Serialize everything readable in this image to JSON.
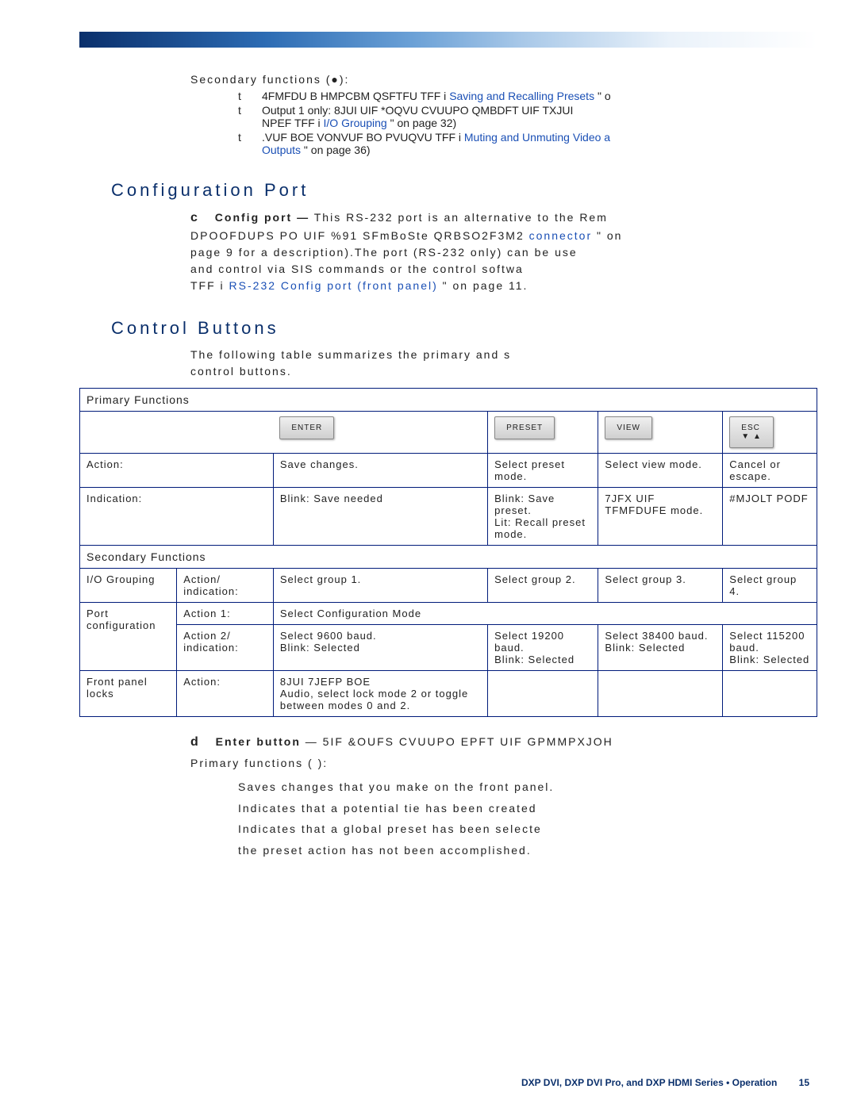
{
  "secondary_label": "Secondary functions (●):",
  "bullets": [
    {
      "pre": "t",
      "garble": "4FMFDU B HMPCBM QSFTFU TFF i",
      "link": "Saving and Recalling Presets",
      "post": "\"  o"
    },
    {
      "pre": "t",
      "garble": "Output 1 only:  8JUI UIF *OQVU  CVUUPO QMBDFT UIF TXJUI",
      "line2": "NPEF TFF i",
      "link": "I/O Grouping",
      "post": "\"  on page 32)"
    },
    {
      "pre": "t",
      "garble": ".VUF BOE VONVUF BO PVUQVU TFF i",
      "link": "Muting and Unmuting Video a",
      "line2pre": "Outputs",
      "post": "\"  on page 36)"
    }
  ],
  "section_config": "Configuration Port",
  "config_para": {
    "c": "c",
    "lead": "Config port —",
    "t1": "This RS-232 port is an alternative to the Rem",
    "t2": "DPOOFDUPS PO UIF %91 SFmBoSte QRBSO2F3M2 ",
    "link1": "connector",
    "t3": "\"  on",
    "t4": "page 9 for a description).The port (RS-232 only) can be use",
    "t5": "and control via SIS commands or the control softwa",
    "t6": "TFF i",
    "link2": "RS-232 Config port (front panel)",
    "t7": "\"  on page 11."
  },
  "section_controls": "Control Buttons",
  "controls_para": "The following table summarizes the primary and s",
  "controls_para2": "control buttons.",
  "table": {
    "primary_hdr": "Primary Functions",
    "btns": [
      "ENTER",
      "PRESET",
      "VIEW",
      "ESC"
    ],
    "btn4_arrows": "▼ ▲",
    "row_action_label": "Action:",
    "row_action": [
      "Save changes.",
      "Select preset mode.",
      "Select view mode.",
      "Cancel or escape."
    ],
    "row_ind_label": "Indication:",
    "row_ind": [
      "Blink: Save needed",
      "Blink: Save preset.\nLit: Recall preset mode.",
      "7JFX UIF TFMFDUFE mode.",
      "#MJOLT PODF"
    ],
    "secondary_hdr": "Secondary Functions",
    "io_label": "I/O Grouping",
    "io_sub": "Action/ indication:",
    "io_cells": [
      "Select group 1.",
      "Select group 2.",
      "Select group 3.",
      "Select group 4."
    ],
    "port_label": "Port configuration",
    "port_a1": "Action 1:",
    "port_a1_val": "Select Configuration Mode",
    "port_a2": "Action 2/ indication:",
    "port_a2_cells": [
      "Select 9600 baud.\nBlink: Selected",
      "Select 19200 baud.\nBlink: Selected",
      "Select 38400 baud.\nBlink: Selected",
      "Select 115200 baud.\nBlink: Selected"
    ],
    "fp_label": "Front panel locks",
    "fp_sub": "Action:",
    "fp_val": "8JUI 7JEFP BOE\nAudio, select lock mode 2 or toggle between modes 0 and 2."
  },
  "enter_d": "d",
  "enter_lead": "Enter button",
  "enter_garble": "— 5IF &OUFS CVUUPO EPFT UIF GPMMPXJOH",
  "primary_funcs_label": "Primary functions (   ):",
  "pf_lines": [
    "Saves changes that you make on the front panel.",
    "Indicates that a potential tie has been created",
    "Indicates that a global preset has been selecte",
    "the preset action has not been accomplished."
  ],
  "footer": {
    "manual": "DXP DVI, DXP DVI Pro, and DXP HDMI Series • Operation",
    "page": "15"
  }
}
